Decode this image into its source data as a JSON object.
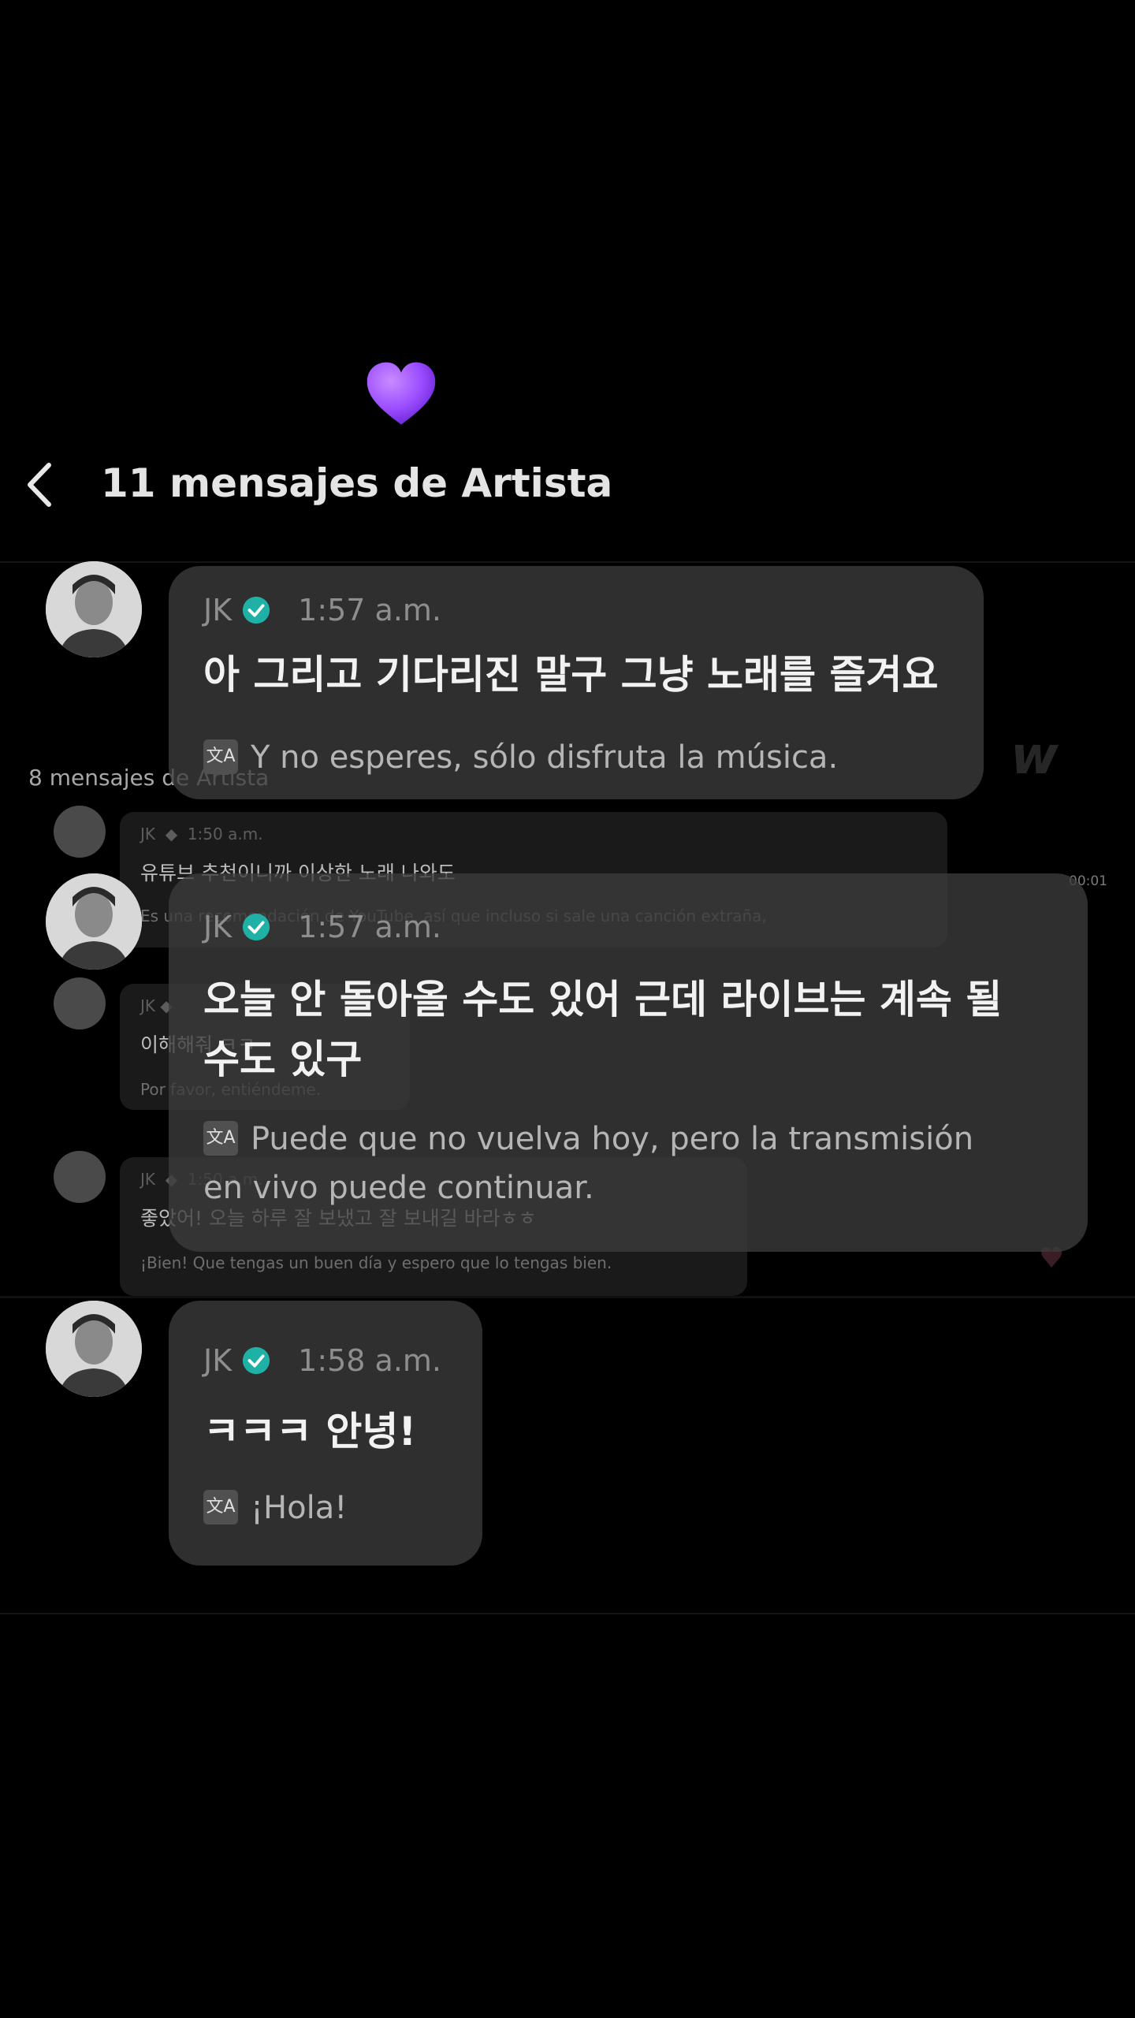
{
  "header": {
    "title": "11  mensajes de Artista",
    "back_label": "back"
  },
  "ghost": {
    "title": "8 mensajes de Artista",
    "time_readout": "00:01",
    "logo": "w",
    "messages": [
      {
        "name": "JK",
        "time": "1:50 a.m.",
        "ko": "유튜브 추천이니까 이상한 노래 나와도",
        "es": "Es una recomendación de YouTube, así que incluso si sale una canción extraña,"
      },
      {
        "name": "JK",
        "time": "",
        "ko": "이해해줘 ㅋㅋ",
        "es": "Por favor, entiéndeme."
      },
      {
        "name": "JK",
        "time": "1:50 a.m.",
        "ko": "좋았어! 오늘 하루 잘 보냈고 잘 보내길 바라ㅎㅎ",
        "es": "¡Bien! Que tengas un buen día y espero que lo tengas bien."
      }
    ]
  },
  "messages": [
    {
      "name": "JK",
      "time": "1:57 a.m.",
      "ko": "아 그리고 기다리진 말구 그냥 노래를 즐겨요",
      "es": "Y no esperes, sólo disfruta la música."
    },
    {
      "name": "JK",
      "time": "1:57 a.m.",
      "ko_line1": "오늘 안 돌아올 수도 있어 근데 라이브는 계속 될",
      "ko_line2": "수도 있구",
      "es_line1": "Puede que no vuelva hoy, pero la transmisión",
      "es_line2": "en vivo puede continuar."
    },
    {
      "name": "JK",
      "time": "1:58 a.m.",
      "ko": "ㅋㅋㅋ 안녕!",
      "es": "¡Hola!"
    }
  ],
  "icons": {
    "heart": "purple-heart-icon",
    "verified": "verified-badge-icon",
    "translate": "translate-icon"
  },
  "colors": {
    "background": "#000000",
    "bubble": "#3c3c3c",
    "verified": "#1fb0a6",
    "heart": "#9b4dff"
  }
}
